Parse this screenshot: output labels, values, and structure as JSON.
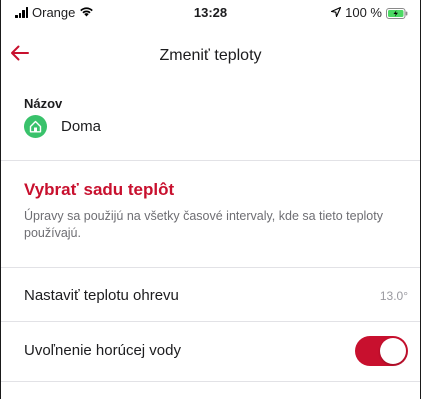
{
  "status_bar": {
    "carrier": "Orange",
    "time": "13:28",
    "battery": "100 %"
  },
  "nav": {
    "title": "Zmeniť teploty"
  },
  "name_section": {
    "label": "Názov",
    "value": "Doma"
  },
  "temperature_set": {
    "title": "Vybrať sadu teplôt",
    "description": "Úpravy sa použijú na všetky časové intervaly, kde sa tieto teploty používajú."
  },
  "rows": {
    "heating": {
      "label": "Nastaviť teplotu ohrevu",
      "value": "13.0°"
    },
    "hot_water": {
      "label": "Uvoľnenie horúcej vody",
      "enabled": true
    }
  },
  "colors": {
    "accent": "#c8102e",
    "home_icon": "#39c26b",
    "battery_charging": "#4cd964"
  }
}
